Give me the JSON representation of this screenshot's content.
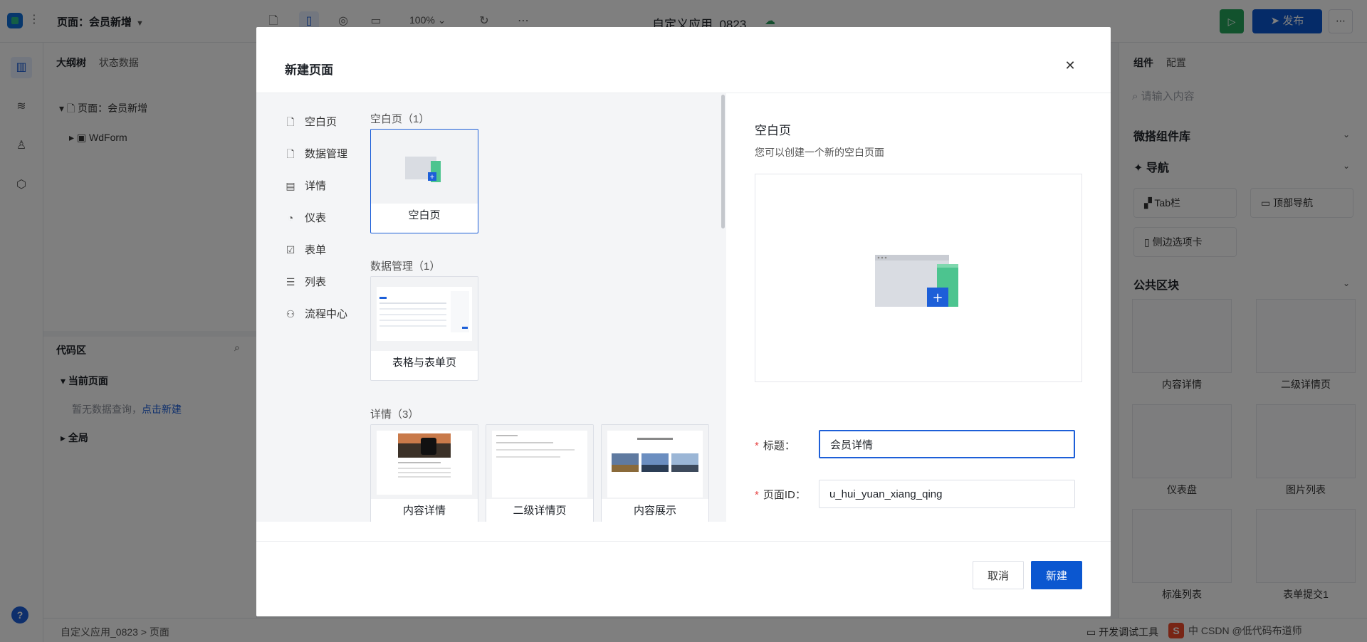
{
  "app": {
    "page_selector": "页面：会员新增",
    "zoom": "100%",
    "title": "自定义应用_0823",
    "publish_label": "发布",
    "left_tabs": [
      "大纲树",
      "状态数据"
    ],
    "tree": {
      "root": "页面：会员新增",
      "child": "WdForm"
    },
    "code": {
      "title": "代码区",
      "current": "当前页面",
      "empty_text": "暂无数据查询，",
      "empty_link": "点击新建",
      "global": "全局"
    },
    "breadcrumb": {
      "app": "自定义应用_0823",
      "sep": ">",
      "page": "页面"
    },
    "devtool_label": "开发调试工具",
    "csdn_text": "中 CSDN @低代码布道师",
    "right_tabs": [
      "组件",
      "配置"
    ],
    "right_search_placeholder": "请输入内容",
    "library_title": "微搭组件库",
    "nav_title": "导航",
    "nav_items": [
      "Tab栏",
      "顶部导航",
      "侧边选项卡"
    ],
    "public_title": "公共区块",
    "public_tiles": [
      "内容详情",
      "二级详情页",
      "仪表盘",
      "图片列表",
      "标准列表",
      "表单提交1"
    ]
  },
  "modal": {
    "title": "新建页面",
    "categories": [
      "空白页",
      "数据管理",
      "详情",
      "仪表",
      "表单",
      "列表",
      "流程中心"
    ],
    "groups": {
      "blank": {
        "title": "空白页（1）",
        "cards": [
          "空白页"
        ]
      },
      "data": {
        "title": "数据管理（1）",
        "cards": [
          "表格与表单页"
        ]
      },
      "detail": {
        "title": "详情（3）",
        "cards": [
          "内容详情",
          "二级详情页",
          "内容展示"
        ]
      }
    },
    "preview": {
      "title": "空白页",
      "description": "您可以创建一个新的空白页面"
    },
    "form": {
      "title_label": "标题：",
      "title_value": "会员详情",
      "id_label": "页面ID：",
      "id_value": "u_hui_yuan_xiang_qing"
    },
    "cancel_label": "取消",
    "create_label": "新建"
  }
}
